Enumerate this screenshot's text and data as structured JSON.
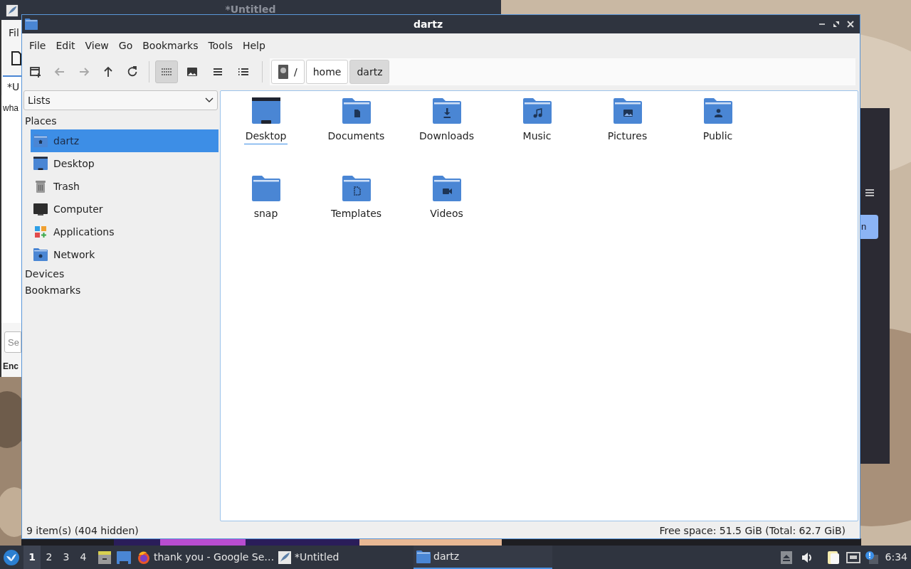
{
  "background_windows": {
    "editor": {
      "title": "*Untitled",
      "menu": "Fil",
      "tab": "*U",
      "text": "wha",
      "search_placeholder": "Se",
      "label": "Enc"
    },
    "browser": {
      "button": "n"
    }
  },
  "window": {
    "title": "dartz"
  },
  "menu": [
    "File",
    "Edit",
    "View",
    "Go",
    "Bookmarks",
    "Tools",
    "Help"
  ],
  "toolbar": [
    {
      "kind": "new-tab",
      "disabled": false
    },
    {
      "kind": "back",
      "disabled": true
    },
    {
      "kind": "forward",
      "disabled": true
    },
    {
      "kind": "up",
      "disabled": false
    },
    {
      "kind": "reload",
      "disabled": false
    }
  ],
  "view_modes": [
    {
      "kind": "icons",
      "selected": true
    },
    {
      "kind": "thumbnails",
      "selected": false
    },
    {
      "kind": "compact",
      "selected": false
    },
    {
      "kind": "detailed",
      "selected": false
    }
  ],
  "path": [
    {
      "label": "/",
      "kind": "root",
      "selected": false
    },
    {
      "label": "home",
      "kind": "dir",
      "selected": false
    },
    {
      "label": "dartz",
      "kind": "dir",
      "selected": true
    }
  ],
  "side_pane": {
    "mode": "Lists",
    "sections": [
      {
        "label": "Places",
        "items": [
          {
            "label": "dartz",
            "kind": "home",
            "selected": true
          },
          {
            "label": "Desktop",
            "kind": "desktop",
            "selected": false
          },
          {
            "label": "Trash",
            "kind": "trash",
            "selected": false
          },
          {
            "label": "Computer",
            "kind": "computer",
            "selected": false
          },
          {
            "label": "Applications",
            "kind": "applications",
            "selected": false
          },
          {
            "label": "Network",
            "kind": "network",
            "selected": false
          }
        ]
      },
      {
        "label": "Devices"
      },
      {
        "label": "Bookmarks"
      }
    ]
  },
  "files": [
    {
      "name": "Desktop",
      "kind": "desktop",
      "focused": true
    },
    {
      "name": "Documents",
      "kind": "documents",
      "focused": false
    },
    {
      "name": "Downloads",
      "kind": "downloads",
      "focused": false
    },
    {
      "name": "Music",
      "kind": "music",
      "focused": false
    },
    {
      "name": "Pictures",
      "kind": "pictures",
      "focused": false
    },
    {
      "name": "Public",
      "kind": "public",
      "focused": false
    },
    {
      "name": "snap",
      "kind": "plain",
      "focused": false
    },
    {
      "name": "Templates",
      "kind": "templates",
      "focused": false
    },
    {
      "name": "Videos",
      "kind": "videos",
      "focused": false
    }
  ],
  "status_bar": {
    "items": "9 item(s) (404 hidden)",
    "free_space": "Free space: 51.5 GiB (Total: 62.7 GiB)"
  },
  "taskbar": {
    "workspaces": [
      {
        "label": "1",
        "selected": true
      },
      {
        "label": "2",
        "selected": false
      },
      {
        "label": "3",
        "selected": false
      },
      {
        "label": "4",
        "selected": false
      }
    ],
    "tasks": [
      {
        "label": "thank you - Google Se…",
        "kind": "browser",
        "selected": false
      },
      {
        "label": "*Untitled",
        "kind": "editor",
        "selected": false
      },
      {
        "label": "dartz",
        "kind": "folder",
        "selected": true
      }
    ],
    "clock": "6:34"
  }
}
